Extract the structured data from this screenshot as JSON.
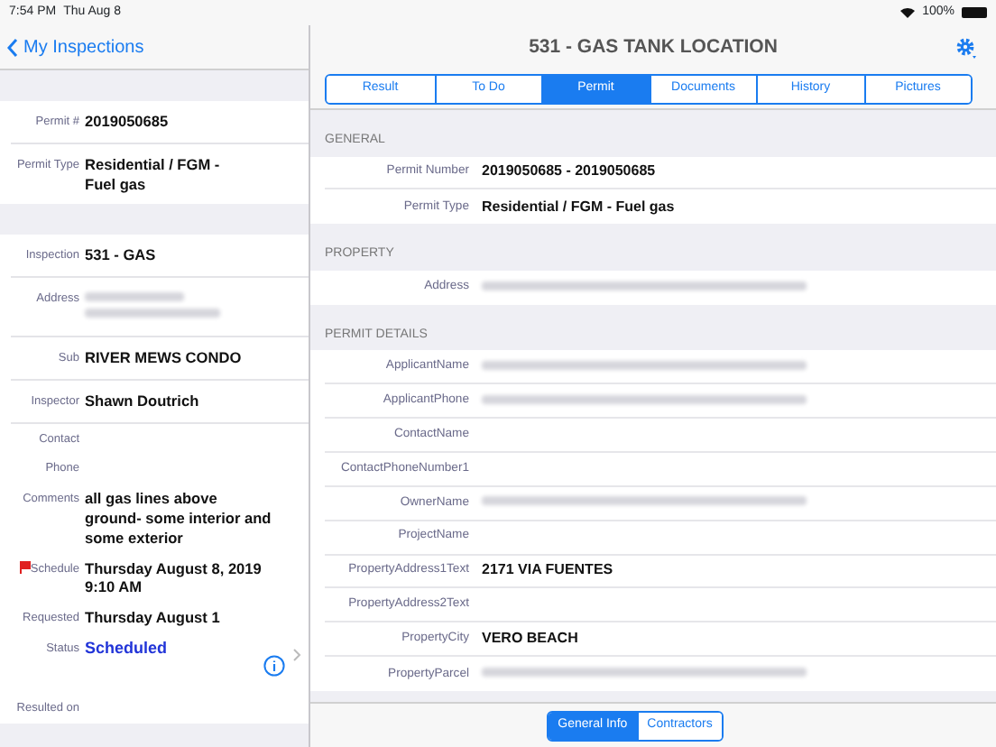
{
  "status_bar": {
    "time": "7:54 PM",
    "date": "Thu Aug 8",
    "battery": "100%"
  },
  "back_button": {
    "label": "My Inspections"
  },
  "title": "531 - GAS TANK LOCATION",
  "tabs": [
    {
      "label": "Result",
      "selected": false
    },
    {
      "label": "To Do",
      "selected": false
    },
    {
      "label": "Permit",
      "selected": true
    },
    {
      "label": "Documents",
      "selected": false
    },
    {
      "label": "History",
      "selected": false
    },
    {
      "label": "Pictures",
      "selected": false
    }
  ],
  "left_sections": [
    {
      "rows": [
        {
          "label": "Permit #",
          "value": "2019050685"
        },
        {
          "label": "Permit Type",
          "value": "Residential / FGM - Fuel gas"
        }
      ]
    },
    {
      "rows": [
        {
          "label": "Inspection",
          "value": "531 - GAS"
        },
        {
          "label": "Address",
          "redacted": true
        },
        {
          "label": "Sub",
          "value": "RIVER MEWS CONDO"
        },
        {
          "label": "Inspector",
          "value": "Shawn Doutrich"
        },
        {
          "label": "Contact",
          "compact": true
        },
        {
          "label": "Phone",
          "compact": true
        },
        {
          "label": "Comments",
          "value": "all gas lines above ground- some interior and some exterior",
          "compact": true
        },
        {
          "label": "Schedule",
          "value": "Thursday August 8, 2019 9:10 AM",
          "flagged": true,
          "compact": true
        },
        {
          "label": "Requested",
          "value": "Thursday August 1",
          "compact": true
        },
        {
          "label": "Status",
          "value": "Scheduled",
          "kind": "status",
          "compact": true
        },
        {
          "label": "Resulted on",
          "compact": true
        }
      ]
    }
  ],
  "right_sections": [
    {
      "header": "GENERAL",
      "rows": [
        {
          "label": "Permit Number",
          "value": "2019050685 - 2019050685"
        },
        {
          "label": "Permit Type",
          "value": "Residential / FGM - Fuel gas"
        }
      ]
    },
    {
      "header": "PROPERTY",
      "rows": [
        {
          "label": "Address",
          "redacted": true
        }
      ]
    },
    {
      "header": "PERMIT DETAILS",
      "rows": [
        {
          "label": "ApplicantName",
          "redacted": true
        },
        {
          "label": "ApplicantPhone",
          "redacted": true
        },
        {
          "label": "ContactName"
        },
        {
          "label": "ContactPhoneNumber1"
        },
        {
          "label": "OwnerName",
          "redacted": true
        },
        {
          "label": "ProjectName"
        },
        {
          "label": "PropertyAddress1Text",
          "value": "2171 VIA FUENTES"
        },
        {
          "label": "PropertyAddress2Text"
        },
        {
          "label": "PropertyCity",
          "value": "VERO BEACH"
        },
        {
          "label": "PropertyParcel",
          "redacted": true
        }
      ]
    }
  ],
  "bottom_tabs": [
    {
      "label": "General Info",
      "selected": true
    },
    {
      "label": "Contractors",
      "selected": false
    }
  ]
}
